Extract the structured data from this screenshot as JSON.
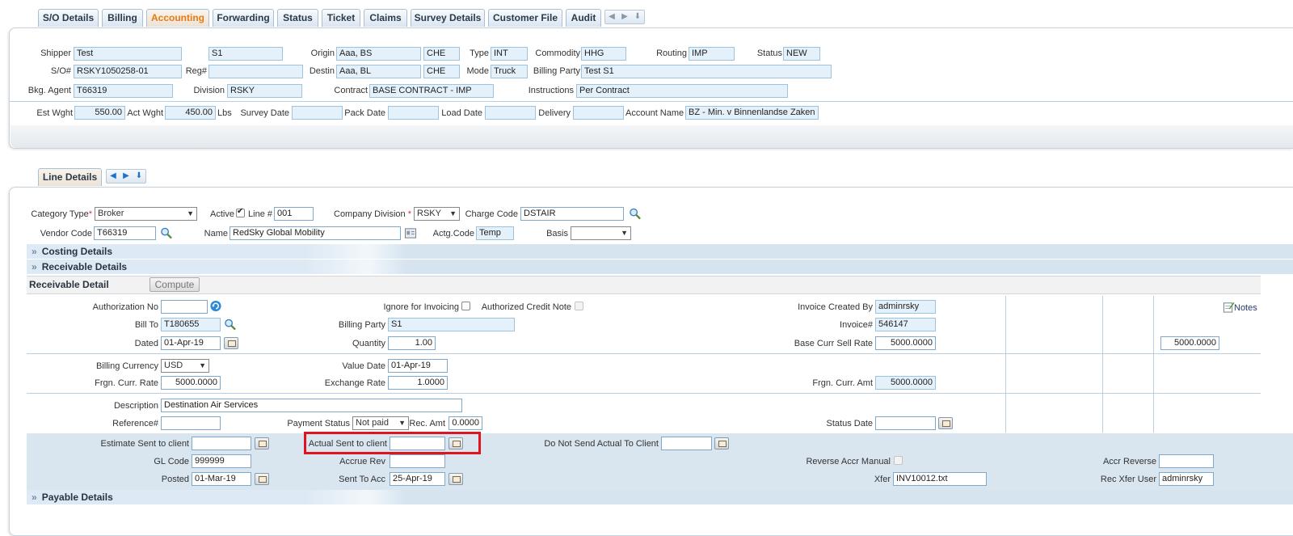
{
  "tabs": [
    "S/O Details",
    "Billing",
    "Accounting",
    "Forwarding",
    "Status",
    "Ticket",
    "Claims",
    "Survey Details",
    "Customer File",
    "Audit"
  ],
  "header": {
    "shipper_label": "Shipper",
    "shipper_value": "Test",
    "shipper2_value": "S1",
    "origin_label": "Origin",
    "origin_value": "Aaa, BS",
    "origin_country": "CHE",
    "type_label": "Type",
    "type_value": "INT",
    "commodity_label": "Commodity",
    "commodity_value": "HHG",
    "routing_label": "Routing",
    "routing_value": "IMP",
    "status_label": "Status",
    "status_value": "NEW",
    "so_label": "S/O#",
    "so_value": "RSKY1050258-01",
    "reg_label": "Reg#",
    "reg_value": "",
    "destin_label": "Destin",
    "destin_value": "Aaa, BL",
    "destin_country": "CHE",
    "mode_label": "Mode",
    "mode_value": "Truck",
    "billing_party_label": "Billing Party",
    "billing_party_value": "Test S1",
    "bkg_agent_label": "Bkg. Agent",
    "bkg_agent_value": "T66319",
    "division_label": "Division",
    "division_value": "RSKY",
    "contract_label": "Contract",
    "contract_value": "BASE CONTRACT - IMP",
    "instructions_label": "Instructions",
    "instructions_value": "Per Contract",
    "est_wght_label": "Est Wght",
    "est_wght_value": "550.00",
    "act_wght_label": "Act Wght",
    "act_wght_value": "450.00",
    "lbs_label": "Lbs",
    "survey_date_label": "Survey Date",
    "survey_date_value": "",
    "pack_date_label": "Pack Date",
    "pack_date_value": "",
    "load_date_label": "Load Date",
    "load_date_value": "",
    "delivery_label": "Delivery",
    "delivery_value": "",
    "account_name_label": "Account Name",
    "account_name_value": "BZ - Min. v Binnenlandse Zaken"
  },
  "line_tab": "Line Details",
  "line": {
    "category_type_label": "Category Type",
    "category_type_value": "Broker",
    "active_label": "Active",
    "line_no_label": "Line #",
    "line_no_value": "001",
    "company_division_label": "Company Division",
    "company_division_value": "RSKY",
    "charge_code_label": "Charge Code",
    "charge_code_value": "DSTAIR",
    "vendor_code_label": "Vendor Code",
    "vendor_code_value": "T66319",
    "name_label": "Name",
    "name_value": "RedSky Global Mobility",
    "actg_code_label": "Actg.Code",
    "actg_code_value": "Temp",
    "basis_label": "Basis",
    "basis_value": ""
  },
  "sections": {
    "costing": "Costing Details",
    "receivable": "Receivable Details",
    "receivable_detail": "Receivable Detail",
    "compute": "Compute",
    "payable": "Payable Details"
  },
  "receivable": {
    "authorization_no_label": "Authorization No",
    "authorization_no_value": "",
    "ignore_invoicing_label": "Ignore for Invoicing",
    "authorized_credit_note_label": "Authorized Credit Note",
    "invoice_created_by_label": "Invoice Created By",
    "invoice_created_by_value": "adminrsky",
    "notes_label": "Notes",
    "bill_to_label": "Bill To",
    "bill_to_value": "T180655",
    "billing_party_label": "Billing Party",
    "billing_party_value": "S1",
    "invoice_no_label": "Invoice#",
    "invoice_no_value": "546147",
    "dated_label": "Dated",
    "dated_value": "01-Apr-19",
    "quantity_label": "Quantity",
    "quantity_value": "1.00",
    "base_curr_sell_rate_label": "Base Curr Sell Rate",
    "base_curr_sell_rate_value": "5000.0000",
    "right_rate_value": "5000.0000",
    "billing_currency_label": "Billing Currency",
    "billing_currency_value": "USD",
    "value_date_label": "Value Date",
    "value_date_value": "01-Apr-19",
    "frgn_curr_rate_label": "Frgn. Curr. Rate",
    "frgn_curr_rate_value": "5000.0000",
    "exchange_rate_label": "Exchange Rate",
    "exchange_rate_value": "1.0000",
    "frgn_curr_amt_label": "Frgn. Curr. Amt",
    "frgn_curr_amt_value": "5000.0000",
    "description_label": "Description",
    "description_value": "Destination Air Services",
    "reference_label": "Reference#",
    "reference_value": "",
    "payment_status_label": "Payment Status",
    "payment_status_value": "Not paid",
    "rec_amt_label": "Rec. Amt",
    "rec_amt_value": "0.0000",
    "status_date_label": "Status Date",
    "status_date_value": "",
    "estimate_sent_label": "Estimate Sent to client",
    "estimate_sent_value": "",
    "actual_sent_label": "Actual Sent to client",
    "actual_sent_value": "",
    "do_not_send_label": "Do Not Send Actual To Client",
    "do_not_send_value": "",
    "gl_code_label": "GL Code",
    "gl_code_value": "999999",
    "accrue_rev_label": "Accrue Rev",
    "accrue_rev_value": "",
    "reverse_accr_manual_label": "Reverse Accr Manual",
    "accr_reverse_label": "Accr Reverse",
    "accr_reverse_value": "",
    "posted_label": "Posted",
    "posted_value": "01-Mar-19",
    "sent_to_acc_label": "Sent To Acc",
    "sent_to_acc_value": "25-Apr-19",
    "xfer_label": "Xfer",
    "xfer_value": "INV10012.txt",
    "rec_xfer_user_label": "Rec Xfer User",
    "rec_xfer_user_value": "adminrsky"
  },
  "colors": {
    "active_tab": "#e57a14",
    "highlight_box": "#e0141e",
    "field_bg": "#e4f1fb"
  }
}
